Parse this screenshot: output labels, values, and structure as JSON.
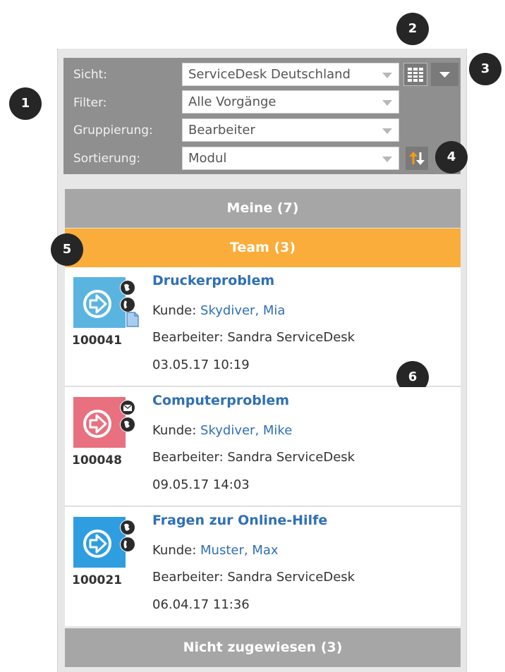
{
  "filters": {
    "view_label": "Sicht:",
    "view_value": "ServiceDesk Deutschland",
    "filter_label": "Filter:",
    "filter_value": "Alle Vorgänge",
    "group_label": "Gruppierung:",
    "group_value": "Bearbeiter",
    "sort_label": "Sortierung:",
    "sort_value": "Modul"
  },
  "callouts": [
    "1",
    "2",
    "3",
    "4",
    "5",
    "6"
  ],
  "groups": {
    "mine": "Meine (7)",
    "team": "Team (3)",
    "unassigned": "Nicht zugewiesen (3)"
  },
  "tickets": [
    {
      "id": "100041",
      "title": "Druckerproblem",
      "customer_label": "Kunde:",
      "customer": "Skydiver, Mia",
      "assignee_label": "Bearbeiter:",
      "assignee": "Sandra ServiceDesk",
      "datetime": "03.05.17 10:19",
      "icon_color": "#5ab4e0",
      "badges": [
        "globe-icon",
        "phone-icon",
        "document-icon"
      ]
    },
    {
      "id": "100048",
      "title": "Computerproblem",
      "customer_label": "Kunde:",
      "customer": "Skydiver, Mike",
      "assignee_label": "Bearbeiter:",
      "assignee": "Sandra ServiceDesk",
      "datetime": "09.05.17 14:03",
      "icon_color": "#e8707f",
      "badges": [
        "mail-icon",
        "globe-icon"
      ]
    },
    {
      "id": "100021",
      "title": "Fragen zur Online-Hilfe",
      "customer_label": "Kunde:",
      "customer": "Muster, Max",
      "assignee_label": "Bearbeiter:",
      "assignee": "Sandra ServiceDesk",
      "datetime": "06.04.17 11:36",
      "icon_color": "#2f9ee0",
      "badges": [
        "globe-icon",
        "phone-icon"
      ]
    }
  ],
  "colors": {
    "team_bar": "#faad3a",
    "group_bar": "#a6a6a6",
    "filter_panel": "#8f8f8f",
    "sort_button": "#f39c12",
    "link_blue": "#2f6fb7"
  }
}
